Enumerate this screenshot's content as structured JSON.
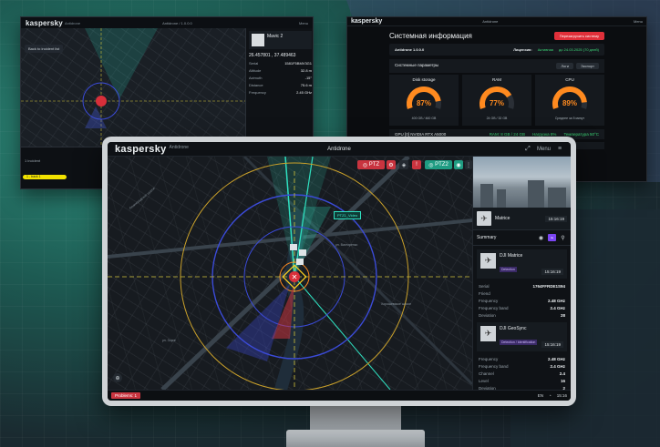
{
  "brand": {
    "logo": "kaspersky",
    "app": "Antidrone"
  },
  "back_left": {
    "center_title": "Antidrone / 1.0.0.0",
    "menu": "Menu",
    "back_button": "Back to incident list",
    "drone_name": "Mavic 2",
    "coords": "26.457801 , 37.489463",
    "fields": [
      {
        "k": "Serial",
        "v": "1581F5BMV3G1"
      },
      {
        "k": "Altitude",
        "v": "32.8 m"
      },
      {
        "k": "Azimuth",
        "v": "-15°"
      },
      {
        "k": "Distance",
        "v": "75.6 m"
      },
      {
        "k": "Frequency",
        "v": "2.45 GHz"
      }
    ],
    "date": "January 17, 2024 · 02:15:54.893 PM",
    "track_label": "1 - track 1",
    "incident_label": "1 incident"
  },
  "back_right": {
    "title": "Системная информация",
    "red_button": "Перезагрузить систему",
    "product": "Antidrone 1.0.0.0",
    "license_label": "Лицензия:",
    "license_status": "Активная",
    "license_expiry": "до 24.03.2025 (70 дней)",
    "section": "Системные параметры",
    "btn1": "Логи",
    "btn2": "Экспорт",
    "gauges": [
      {
        "label": "Disk storage",
        "pct": "87%",
        "sub": "400 GB / 460 GB",
        "fill": 0.87
      },
      {
        "label": "RAM",
        "pct": "77%",
        "sub": "24 GB / 32 GB",
        "fill": 0.77
      },
      {
        "label": "CPU",
        "pct": "89%",
        "sub": "Среднее за 5 минут",
        "fill": 0.89
      }
    ],
    "gpu": "GPU [0] NVIDIA RTX A5000",
    "gpu_ram": "RAM: 8 GB / 24 GB",
    "gpu_load": "Нагрузка 8%",
    "gpu_temp": "Температура 50°C"
  },
  "main": {
    "center_title": "Antidrone",
    "menu": "Menu",
    "tool_ptz": "PTZ",
    "tool_ptz2": "PTZ2",
    "map_label_1": "PTZ1_Video",
    "streets": [
      "Ленинградское шоссе",
      "ул. Викторенко",
      "ул. Зорге",
      "Хорошевское шоссе"
    ],
    "side": {
      "drone_name": "Matrice",
      "drone_time": "15:16:19",
      "summary": "Summary",
      "card1": {
        "name": "DJI Matrice",
        "badge": "Detection",
        "time": "15:16:19"
      },
      "fields1": [
        {
          "k": "Serial",
          "v": "1764FFRDE1S94"
        },
        {
          "k": "Friend",
          "v": ""
        },
        {
          "k": "Frequency",
          "v": "2.48 GHz"
        },
        {
          "k": "Frequency band",
          "v": "2.4 GHz"
        },
        {
          "k": "Deviation",
          "v": "28"
        }
      ],
      "card2": {
        "name": "DJI GeoSync",
        "badge": "Detection / Identification",
        "time": "15:16:19"
      },
      "fields2": [
        {
          "k": "Frequency",
          "v": "2.48 GHz"
        },
        {
          "k": "Frequency band",
          "v": "2.4 GHz"
        },
        {
          "k": "Channel",
          "v": "2.4"
        },
        {
          "k": "Level",
          "v": "16"
        },
        {
          "k": "Deviation",
          "v": "2"
        }
      ]
    },
    "problems": "Problems: 1",
    "status_lang": "EN",
    "status_time": "15:16"
  },
  "colors": {
    "accent": "#2fe0c0",
    "danger": "#c9343f",
    "gauge": "#ff8a1f",
    "purple": "#7b45f2"
  }
}
